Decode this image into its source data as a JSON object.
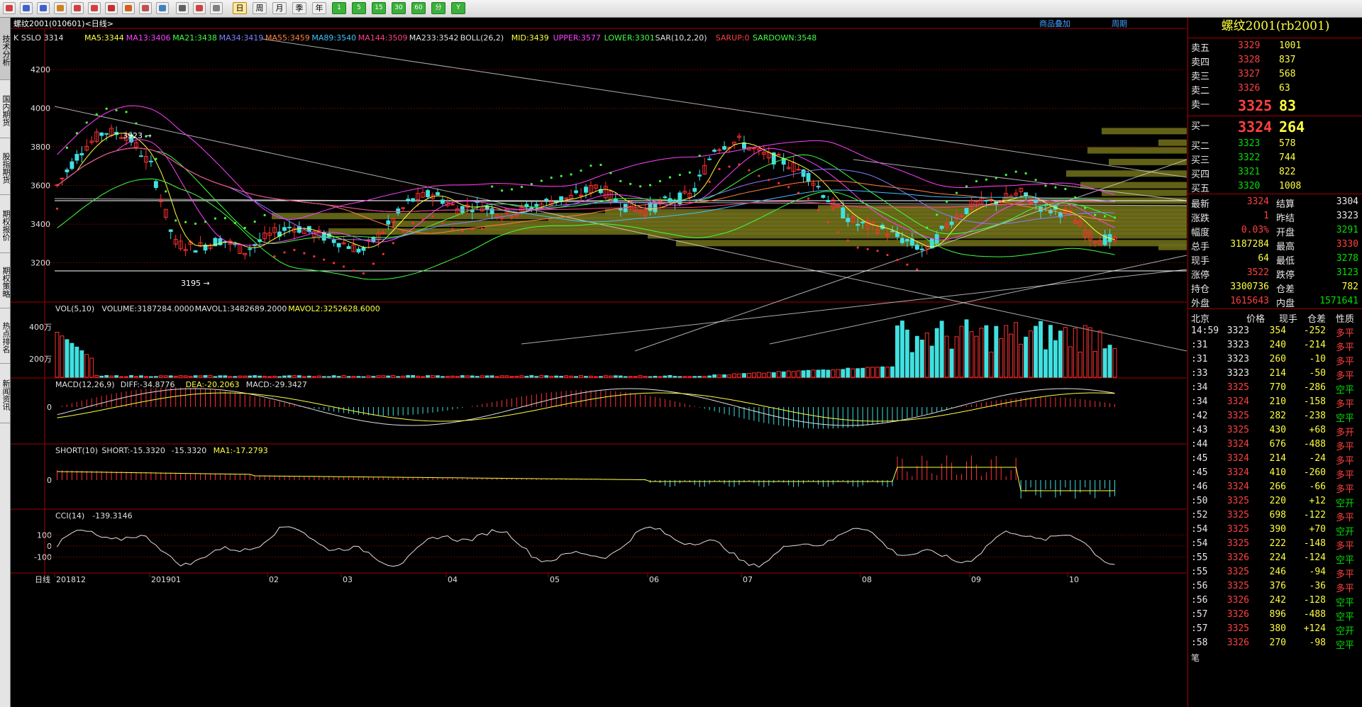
{
  "toolbar": {
    "icons": [
      "home-icon",
      "back-icon",
      "forward-icon",
      "list-icon",
      "search-icon",
      "zoom-icon",
      "draw-icon",
      "pen-icon",
      "filter-icon",
      "settings-icon",
      "table-icon",
      "line-chart-icon",
      "tick-icon"
    ],
    "periods": [
      "日",
      "周",
      "月",
      "季",
      "年",
      "1",
      "5",
      "15",
      "30",
      "60",
      "分",
      "Y"
    ],
    "selected_period": "日"
  },
  "sidebar": {
    "tabs": [
      "技术分析",
      "国内期货",
      "股指期货",
      "期权报价",
      "期权策略",
      "热点排名",
      "新闻资讯"
    ]
  },
  "chart_title": "螺纹2001(010601)<日线>",
  "chart_links": [
    "商品叠加",
    "周期"
  ],
  "indicator_line": {
    "label": "K SSLO 3314",
    "items": [
      {
        "text": "MA5:3344",
        "color": "#ffff40"
      },
      {
        "text": "MA13:3406",
        "color": "#ff40ff"
      },
      {
        "text": "MA21:3438",
        "color": "#40ff40"
      },
      {
        "text": "MA34:3419",
        "color": "#8080ff"
      },
      {
        "text": "MA55:3459",
        "color": "#ff8040"
      },
      {
        "text": "MA89:3540",
        "color": "#40c0ff"
      },
      {
        "text": "MA144:3509",
        "color": "#ff4080"
      },
      {
        "text": "MA233:3542",
        "color": "#e0e0e0"
      },
      {
        "text": "BOLL(26,2)",
        "color": "#e0e0e0"
      },
      {
        "text": "MID:3439",
        "color": "#ffff40"
      },
      {
        "text": "UPPER:3577",
        "color": "#ff40ff"
      },
      {
        "text": "LOWER:3301",
        "color": "#40ff40"
      },
      {
        "text": "SAR(10,2,20)",
        "color": "#e0e0e0"
      },
      {
        "text": "SARUP:0",
        "color": "#ff4040"
      },
      {
        "text": "SARDOWN:3548",
        "color": "#40ff40"
      }
    ]
  },
  "price_axis": [
    "4200",
    "4000",
    "3800",
    "3600",
    "3400",
    "3200"
  ],
  "annotations": {
    "high": "3923",
    "low": "3195"
  },
  "volume": {
    "label": "VOL(5,10)",
    "items": [
      {
        "text": "VOLUME:3187284.0000",
        "color": "#e0e0e0"
      },
      {
        "text": "MAVOL1:3482689.2000",
        "color": "#e0e0e0"
      },
      {
        "text": "MAVOL2:3252628.6000",
        "color": "#ffff40"
      }
    ],
    "axis": [
      "400万",
      "200万"
    ]
  },
  "macd": {
    "label": "MACD(12,26,9)",
    "items": [
      {
        "text": "DIFF:-34.8776",
        "color": "#e0e0e0"
      },
      {
        "text": "DEA:-20.2063",
        "color": "#ffff40"
      },
      {
        "text": "MACD:-29.3427",
        "color": "#e0e0e0"
      }
    ],
    "axis": [
      "0"
    ]
  },
  "short": {
    "label": "SHORT(10)",
    "items": [
      {
        "text": "SHORT:-15.3320",
        "color": "#e0e0e0"
      },
      {
        "text": "-15.3320",
        "color": "#e0e0e0"
      },
      {
        "text": "MA1:-17.2793",
        "color": "#ffff40"
      }
    ],
    "axis": [
      "0"
    ]
  },
  "cci": {
    "label": "CCI(14)",
    "items": [
      {
        "text": "-139.3146",
        "color": "#e0e0e0"
      }
    ],
    "axis": [
      "100",
      "0",
      "-100"
    ]
  },
  "x_axis": {
    "period_label": "日线",
    "labels": [
      "201812",
      "201901",
      "02",
      "03",
      "04",
      "05",
      "06",
      "07",
      "08",
      "09",
      "10"
    ]
  },
  "chart_data": {
    "type": "candlestick",
    "x": [
      "201812",
      "201901",
      "02",
      "03",
      "04",
      "05",
      "06",
      "07",
      "08",
      "09",
      "10"
    ],
    "ylim": [
      3000,
      4300
    ],
    "y_ticks": [
      4200,
      4000,
      3800,
      3600,
      3400,
      3200
    ],
    "high_marker": 3923,
    "low_marker": 3195,
    "close_trend": [
      3600,
      3780,
      3880,
      3860,
      3700,
      3300,
      3280,
      3320,
      3260,
      3340,
      3390,
      3350,
      3310,
      3260,
      3380,
      3520,
      3560,
      3480,
      3500,
      3450,
      3480,
      3520,
      3540,
      3600,
      3500,
      3470,
      3520,
      3550,
      3800,
      3830,
      3760,
      3720,
      3650,
      3500,
      3400,
      3380,
      3320,
      3260,
      3420,
      3500,
      3520,
      3560,
      3480,
      3460,
      3330,
      3314
    ]
  },
  "quote": {
    "title": "螺纹2001(rb2001)",
    "asks": [
      {
        "label": "卖五",
        "price": "3329",
        "vol": "1001"
      },
      {
        "label": "卖四",
        "price": "3328",
        "vol": "837"
      },
      {
        "label": "卖三",
        "price": "3327",
        "vol": "568"
      },
      {
        "label": "卖二",
        "price": "3326",
        "vol": "63"
      },
      {
        "label": "卖一",
        "price": "3325",
        "vol": "83"
      }
    ],
    "bids": [
      {
        "label": "买一",
        "price": "3324",
        "vol": "264"
      },
      {
        "label": "买二",
        "price": "3323",
        "vol": "578"
      },
      {
        "label": "买三",
        "price": "3322",
        "vol": "744"
      },
      {
        "label": "买四",
        "price": "3321",
        "vol": "822"
      },
      {
        "label": "买五",
        "price": "3320",
        "vol": "1008"
      }
    ],
    "stats": [
      {
        "l1": "最新",
        "v1": "3324",
        "c1": "red",
        "l2": "结算",
        "v2": "3304",
        "c2": "white"
      },
      {
        "l1": "涨跌",
        "v1": "1",
        "c1": "red",
        "l2": "昨结",
        "v2": "3323",
        "c2": "white"
      },
      {
        "l1": "幅度",
        "v1": "0.03%",
        "c1": "red",
        "l2": "开盘",
        "v2": "3291",
        "c2": "green"
      },
      {
        "l1": "总手",
        "v1": "3187284",
        "c1": "yellow",
        "l2": "最高",
        "v2": "3330",
        "c2": "red"
      },
      {
        "l1": "现手",
        "v1": "64",
        "c1": "yellow",
        "l2": "最低",
        "v2": "3278",
        "c2": "green"
      },
      {
        "l1": "涨停",
        "v1": "3522",
        "c1": "red",
        "l2": "跌停",
        "v2": "3123",
        "c2": "green"
      },
      {
        "l1": "持仓",
        "v1": "3300736",
        "c1": "yellow",
        "l2": "仓差",
        "v2": "782",
        "c2": "yellow"
      },
      {
        "l1": "外盘",
        "v1": "1615643",
        "c1": "red",
        "l2": "内盘",
        "v2": "1571641",
        "c2": "green"
      }
    ],
    "ticks_header": [
      "北京",
      "价格",
      "现手",
      "仓差",
      "性质"
    ],
    "ticks": [
      {
        "t": "14:59",
        "p": "3323",
        "v": "354",
        "d": "-252",
        "n": "多平",
        "pc": "white",
        "nc": "red"
      },
      {
        "t": ":31",
        "p": "3323",
        "v": "240",
        "d": "-214",
        "n": "多平",
        "pc": "white",
        "nc": "red"
      },
      {
        "t": ":31",
        "p": "3323",
        "v": "260",
        "d": "-10",
        "n": "多平",
        "pc": "white",
        "nc": "red"
      },
      {
        "t": ":33",
        "p": "3323",
        "v": "214",
        "d": "-50",
        "n": "多平",
        "pc": "white",
        "nc": "red"
      },
      {
        "t": ":34",
        "p": "3325",
        "v": "770",
        "d": "-286",
        "n": "空平",
        "pc": "red",
        "nc": "green"
      },
      {
        "t": ":34",
        "p": "3324",
        "v": "210",
        "d": "-158",
        "n": "多平",
        "pc": "red",
        "nc": "red"
      },
      {
        "t": ":42",
        "p": "3325",
        "v": "282",
        "d": "-238",
        "n": "空平",
        "pc": "red",
        "nc": "green"
      },
      {
        "t": ":43",
        "p": "3325",
        "v": "430",
        "d": "+68",
        "n": "多开",
        "pc": "red",
        "nc": "red"
      },
      {
        "t": ":44",
        "p": "3324",
        "v": "676",
        "d": "-488",
        "n": "多平",
        "pc": "red",
        "nc": "red"
      },
      {
        "t": ":45",
        "p": "3324",
        "v": "214",
        "d": "-24",
        "n": "多平",
        "pc": "red",
        "nc": "red"
      },
      {
        "t": ":45",
        "p": "3324",
        "v": "410",
        "d": "-260",
        "n": "多平",
        "pc": "red",
        "nc": "red"
      },
      {
        "t": ":46",
        "p": "3324",
        "v": "266",
        "d": "-66",
        "n": "多平",
        "pc": "red",
        "nc": "red"
      },
      {
        "t": ":50",
        "p": "3325",
        "v": "220",
        "d": "+12",
        "n": "空开",
        "pc": "red",
        "nc": "green"
      },
      {
        "t": ":52",
        "p": "3325",
        "v": "698",
        "d": "-122",
        "n": "多平",
        "pc": "red",
        "nc": "red"
      },
      {
        "t": ":54",
        "p": "3325",
        "v": "390",
        "d": "+70",
        "n": "空开",
        "pc": "red",
        "nc": "green"
      },
      {
        "t": ":54",
        "p": "3325",
        "v": "222",
        "d": "-148",
        "n": "多平",
        "pc": "red",
        "nc": "red"
      },
      {
        "t": ":55",
        "p": "3326",
        "v": "224",
        "d": "-124",
        "n": "空平",
        "pc": "red",
        "nc": "green"
      },
      {
        "t": ":55",
        "p": "3325",
        "v": "246",
        "d": "-94",
        "n": "多平",
        "pc": "red",
        "nc": "red"
      },
      {
        "t": ":56",
        "p": "3325",
        "v": "376",
        "d": "-36",
        "n": "多平",
        "pc": "red",
        "nc": "red"
      },
      {
        "t": ":56",
        "p": "3326",
        "v": "242",
        "d": "-128",
        "n": "空平",
        "pc": "red",
        "nc": "green"
      },
      {
        "t": ":57",
        "p": "3326",
        "v": "896",
        "d": "-488",
        "n": "空平",
        "pc": "red",
        "nc": "green"
      },
      {
        "t": ":57",
        "p": "3325",
        "v": "380",
        "d": "+124",
        "n": "空开",
        "pc": "red",
        "nc": "green"
      },
      {
        "t": ":58",
        "p": "3326",
        "v": "270",
        "d": "-98",
        "n": "空平",
        "pc": "red",
        "nc": "green"
      }
    ],
    "footer": "笔"
  }
}
